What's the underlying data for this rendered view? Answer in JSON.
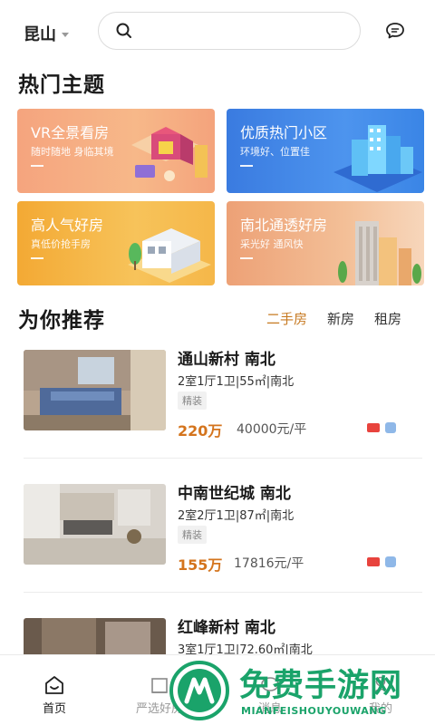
{
  "header": {
    "city": "昆山",
    "search_placeholder": ""
  },
  "hot_topics": {
    "title": "热门主题",
    "cards": [
      {
        "title": "VR全景看房",
        "subtitle": "随时随地 身临其境",
        "dash": "—"
      },
      {
        "title": "优质热门小区",
        "subtitle": "环境好、位置佳",
        "dash": "—"
      },
      {
        "title": "高人气好房",
        "subtitle": "真低价抢手房",
        "dash": "—"
      },
      {
        "title": "南北通透好房",
        "subtitle": "采光好 通风快",
        "dash": "—"
      }
    ]
  },
  "recommend": {
    "title": "为你推荐",
    "tabs": [
      {
        "label": "二手房",
        "active": true
      },
      {
        "label": "新房",
        "active": false
      },
      {
        "label": "租房",
        "active": false
      }
    ]
  },
  "listings": [
    {
      "title": "通山新村 南北",
      "spec": "2室1厅1卫|55㎡|南北",
      "tag": "精装",
      "price": "220万",
      "unit_price": "40000元/平"
    },
    {
      "title": "中南世纪城 南北",
      "spec": "2室2厅1卫|87㎡|南北",
      "tag": "精装",
      "price": "155万",
      "unit_price": "17816元/平"
    },
    {
      "title": "红峰新村 南北",
      "spec": "3室1厅1卫|72.60㎡|南北",
      "tag": "",
      "price": "",
      "unit_price": ""
    }
  ],
  "bottom_nav": [
    {
      "label": "首页",
      "active": true,
      "icon": "home-icon"
    },
    {
      "label": "严选好房",
      "active": false,
      "icon": "house-select-icon"
    },
    {
      "label": "消息",
      "active": false,
      "icon": "chat-icon"
    },
    {
      "label": "我的",
      "active": false,
      "icon": "profile-icon"
    }
  ],
  "watermark": {
    "text": "免费手游网",
    "subtext": "MIANFEISHOUYOUWANG"
  },
  "colors": {
    "accent": "#c77a22",
    "price": "#d4741d",
    "watermark": "#1aa36a"
  }
}
